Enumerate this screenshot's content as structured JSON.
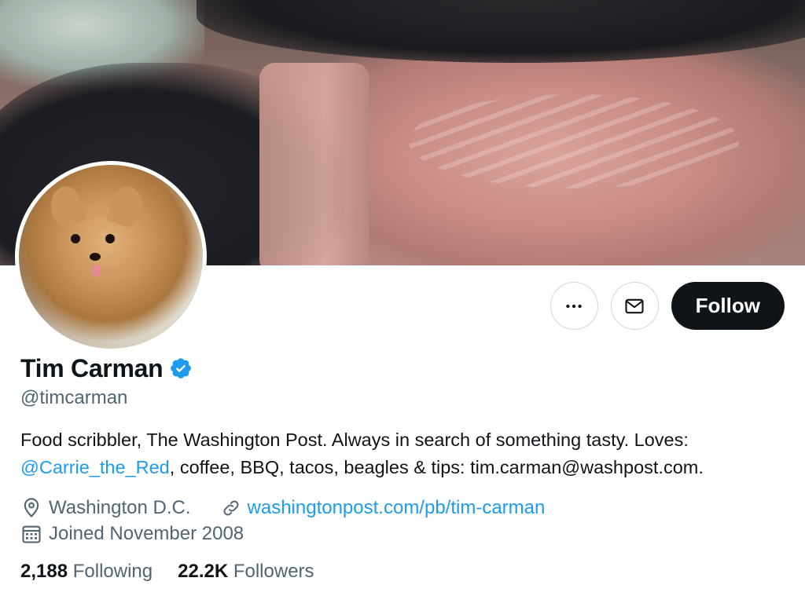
{
  "banner": {
    "alt": "banner-image"
  },
  "profile": {
    "name": "Tim Carman",
    "handle": "@timcarman",
    "verified": true,
    "bio_part1": "Food scribbler, The Washington Post. Always in search of something tasty. Loves:",
    "bio_mention": "@Carrie_the_Red",
    "bio_part2": ", coffee, BBQ, tacos, beagles & tips: tim.carman@washpost.com.",
    "location": "Washington D.C.",
    "website": "washingtonpost.com/pb/tim-carman",
    "joined": "Joined November 2008"
  },
  "stats": {
    "following_count": "2,188",
    "following_label": "Following",
    "followers_count": "22.2K",
    "followers_label": "Followers"
  },
  "actions": {
    "more_icon": "more-horizontal-icon",
    "message_icon": "envelope-icon",
    "follow_label": "Follow"
  },
  "colors": {
    "accent": "#1d9bf0",
    "text": "#0f1419",
    "secondary": "#536471",
    "button_bg": "#0f1419"
  }
}
